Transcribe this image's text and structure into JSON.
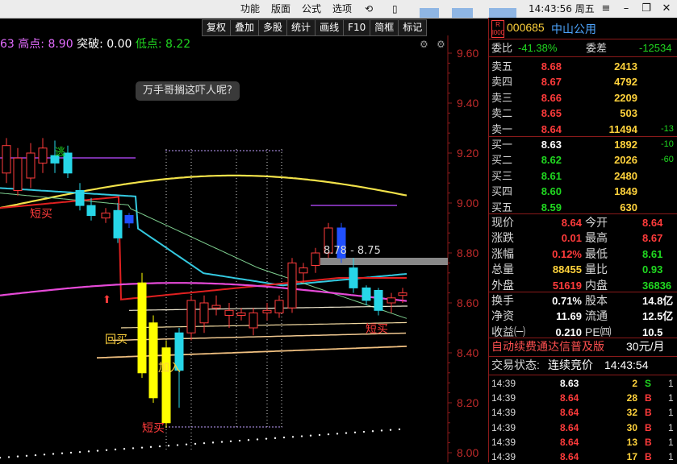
{
  "topbar": {
    "menus": [
      "功能",
      "版面",
      "公式",
      "选项"
    ],
    "time": "14:43:56",
    "weekday": "周五",
    "window_buttons": [
      "≡",
      "–",
      "❐",
      "✕"
    ]
  },
  "toolbar": {
    "buttons": [
      "复权",
      "叠加",
      "多股",
      "统计",
      "画线",
      "F10",
      "简框",
      "标记"
    ]
  },
  "chart_info": {
    "prefix": "63",
    "high_label": "高点:",
    "high_value": "8.90",
    "breakout_label": "突破:",
    "breakout_value": "0.00",
    "low_label": "低点:",
    "low_value": "8.22"
  },
  "tooltip": "万手哥搁这吓人呢?",
  "price_range_box": "8.78 - 8.75",
  "chart_annotations": {
    "escape": "逃",
    "short_buy_1": "短买",
    "buy_back": "回买",
    "add": "加入",
    "short_buy_2": "短买",
    "short_buy_3": "短买"
  },
  "chart_data": {
    "type": "candlestick",
    "y_ticks": [
      "9.60",
      "9.40",
      "9.20",
      "9.00",
      "8.80",
      "8.60",
      "8.40",
      "8.20",
      "8.00"
    ],
    "ylim": [
      8.0,
      9.6
    ],
    "candles": [
      {
        "o": 9.12,
        "c": 9.23,
        "h": 9.26,
        "l": 9.08,
        "up": true
      },
      {
        "o": 9.05,
        "c": 9.18,
        "h": 9.22,
        "l": 9.03,
        "up": true
      },
      {
        "o": 9.1,
        "c": 9.2,
        "h": 9.24,
        "l": 9.06,
        "up": true
      },
      {
        "o": 9.16,
        "c": 9.22,
        "h": 9.26,
        "l": 9.12,
        "up": true
      },
      {
        "o": 9.19,
        "c": 9.16,
        "h": 9.25,
        "l": 9.12,
        "up": true
      },
      {
        "o": 9.2,
        "c": 9.12,
        "h": 9.23,
        "l": 9.1,
        "up": false
      },
      {
        "o": 9.05,
        "c": 8.99,
        "h": 9.08,
        "l": 8.97,
        "up": false
      },
      {
        "o": 8.99,
        "c": 8.95,
        "h": 9.02,
        "l": 8.93,
        "up": false
      },
      {
        "o": 8.94,
        "c": 8.96,
        "h": 8.98,
        "l": 8.92,
        "up": true
      },
      {
        "o": 8.97,
        "c": 8.86,
        "h": 9.0,
        "l": 8.84,
        "up": true
      },
      {
        "o": 8.92,
        "c": 8.95,
        "h": 8.96,
        "l": 8.9,
        "up": false
      },
      {
        "o": 8.68,
        "c": 8.32,
        "h": 8.72,
        "l": 8.3,
        "up": false
      },
      {
        "o": 8.52,
        "c": 8.22,
        "h": 8.55,
        "l": 8.2,
        "up": false
      },
      {
        "o": 8.42,
        "c": 8.12,
        "h": 8.45,
        "l": 8.1,
        "up": false
      },
      {
        "o": 8.48,
        "c": 8.33,
        "h": 8.5,
        "l": 8.18,
        "up": true
      },
      {
        "o": 8.48,
        "c": 8.61,
        "h": 8.63,
        "l": 8.45,
        "up": true
      },
      {
        "o": 8.52,
        "c": 8.6,
        "h": 8.63,
        "l": 8.48,
        "up": true
      },
      {
        "o": 8.58,
        "c": 8.59,
        "h": 8.63,
        "l": 8.55,
        "up": false
      },
      {
        "o": 8.55,
        "c": 8.57,
        "h": 8.6,
        "l": 8.5,
        "up": true
      },
      {
        "o": 8.55,
        "c": 8.56,
        "h": 8.58,
        "l": 8.53,
        "up": false
      },
      {
        "o": 8.5,
        "c": 8.56,
        "h": 8.58,
        "l": 8.47,
        "up": true
      },
      {
        "o": 8.56,
        "c": 8.57,
        "h": 8.6,
        "l": 8.53,
        "up": false
      },
      {
        "o": 8.56,
        "c": 8.61,
        "h": 8.63,
        "l": 8.54,
        "up": true
      },
      {
        "o": 8.58,
        "c": 8.76,
        "h": 8.78,
        "l": 8.56,
        "up": true
      },
      {
        "o": 8.72,
        "c": 8.74,
        "h": 8.76,
        "l": 8.68,
        "up": false
      },
      {
        "o": 8.75,
        "c": 8.8,
        "h": 8.82,
        "l": 8.72,
        "up": true
      },
      {
        "o": 8.8,
        "c": 8.9,
        "h": 8.92,
        "l": 8.78,
        "up": true
      },
      {
        "o": 8.9,
        "c": 8.78,
        "h": 8.92,
        "l": 8.76,
        "up": false
      },
      {
        "o": 8.74,
        "c": 8.66,
        "h": 8.78,
        "l": 8.64,
        "up": false
      },
      {
        "o": 8.66,
        "c": 8.61,
        "h": 8.67,
        "l": 8.59,
        "up": false
      },
      {
        "o": 8.65,
        "c": 8.57,
        "h": 8.66,
        "l": 8.55,
        "up": false
      },
      {
        "o": 8.6,
        "c": 8.62,
        "h": 8.64,
        "l": 8.56,
        "up": true
      },
      {
        "o": 8.63,
        "c": 8.64,
        "h": 8.66,
        "l": 8.6,
        "up": true
      },
      {
        "o": 8.7,
        "c": 8.64,
        "h": 8.72,
        "l": 8.62,
        "up": false
      },
      {
        "o": 8.64,
        "c": 8.62,
        "h": 8.66,
        "l": 8.6,
        "up": true
      },
      {
        "o": 8.64,
        "c": 8.65,
        "h": 8.67,
        "l": 8.63,
        "up": true
      }
    ]
  },
  "quote": {
    "code": "000685",
    "name": "中山公用",
    "badge": "R\nl000",
    "weibi_label": "委比",
    "weibi_value": "-41.38%",
    "weicha_label": "委差",
    "weicha_value": "-12534",
    "asks": [
      {
        "label": "卖五",
        "price": "8.68",
        "vol": "2413",
        "chg": ""
      },
      {
        "label": "卖四",
        "price": "8.67",
        "vol": "4792",
        "chg": ""
      },
      {
        "label": "卖三",
        "price": "8.66",
        "vol": "2209",
        "chg": ""
      },
      {
        "label": "卖二",
        "price": "8.65",
        "vol": "503",
        "chg": ""
      },
      {
        "label": "卖一",
        "price": "8.64",
        "vol": "11494",
        "chg": "-13"
      }
    ],
    "bids": [
      {
        "label": "买一",
        "price": "8.63",
        "vol": "1892",
        "chg": "-10"
      },
      {
        "label": "买二",
        "price": "8.62",
        "vol": "2026",
        "chg": "-60"
      },
      {
        "label": "买三",
        "price": "8.61",
        "vol": "2480",
        "chg": ""
      },
      {
        "label": "买四",
        "price": "8.60",
        "vol": "1849",
        "chg": ""
      },
      {
        "label": "买五",
        "price": "8.59",
        "vol": "630",
        "chg": ""
      }
    ],
    "stats": [
      {
        "l1": "现价",
        "v1": "8.64",
        "c1": "red",
        "l2": "今开",
        "v2": "8.64",
        "c2": "red"
      },
      {
        "l1": "涨跌",
        "v1": "0.01",
        "c1": "red",
        "l2": "最高",
        "v2": "8.67",
        "c2": "red"
      },
      {
        "l1": "涨幅",
        "v1": "0.12%",
        "c1": "red",
        "l2": "最低",
        "v2": "8.61",
        "c2": "green"
      },
      {
        "l1": "总量",
        "v1": "88455",
        "c1": "yellow",
        "l2": "量比",
        "v2": "0.93",
        "c2": "green"
      },
      {
        "l1": "外盘",
        "v1": "51619",
        "c1": "red",
        "l2": "内盘",
        "v2": "36836",
        "c2": "green"
      }
    ],
    "stats2": [
      {
        "l1": "换手",
        "v1": "0.71%",
        "c1": "white",
        "l2": "股本",
        "v2": "14.8亿",
        "c2": "white"
      },
      {
        "l1": "净资",
        "v1": "11.69",
        "c1": "white",
        "l2": "流通",
        "v2": "12.5亿",
        "c2": "white"
      },
      {
        "l1": "收益㈠",
        "v1": "0.210",
        "c1": "white",
        "l2": "PE㈣",
        "v2": "10.5",
        "c2": "white"
      }
    ],
    "banner": "自动续费通达信普及版",
    "banner_price": "30元/月",
    "trade_status_label": "交易状态:",
    "trade_status_value": "连续竞价",
    "trade_status_time": "14:43:54",
    "ticks": [
      {
        "t": "14:39",
        "p": "8.63",
        "pc": "white",
        "v": "2",
        "bs": "S",
        "bsc": "green",
        "n": "1"
      },
      {
        "t": "14:39",
        "p": "8.64",
        "pc": "red",
        "v": "28",
        "bs": "B",
        "bsc": "red",
        "n": "1"
      },
      {
        "t": "14:39",
        "p": "8.64",
        "pc": "red",
        "v": "32",
        "bs": "B",
        "bsc": "red",
        "n": "1"
      },
      {
        "t": "14:39",
        "p": "8.64",
        "pc": "red",
        "v": "30",
        "bs": "B",
        "bsc": "red",
        "n": "1"
      },
      {
        "t": "14:39",
        "p": "8.64",
        "pc": "red",
        "v": "13",
        "bs": "B",
        "bsc": "red",
        "n": "1"
      },
      {
        "t": "14:39",
        "p": "8.64",
        "pc": "red",
        "v": "17",
        "bs": "B",
        "bsc": "red",
        "n": "1"
      }
    ]
  },
  "colors": {
    "up": "#ff3b3b",
    "down": "#27d6e8",
    "yellow": "#ffd23c",
    "green": "#20d820",
    "ma_yellow": "#f2e24a",
    "ma_magenta": "#e64ad8",
    "ma_red": "#e02020",
    "ma_cyan": "#34c9e0"
  }
}
